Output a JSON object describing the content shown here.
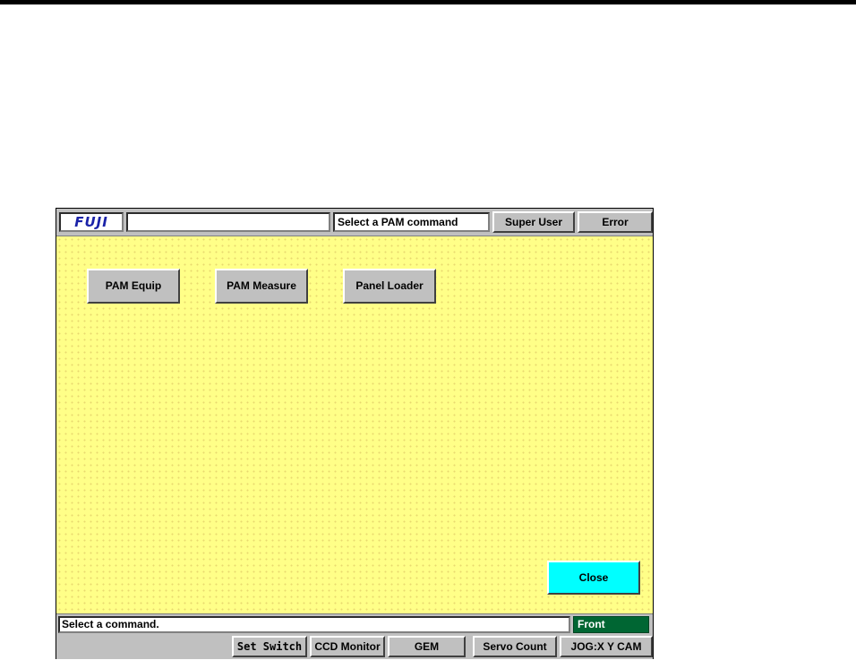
{
  "header": {
    "logo_text": "FUJI",
    "title_value": "",
    "prompt": "Select a PAM command",
    "user_button": "Super User",
    "error_button": "Error"
  },
  "commands": [
    {
      "label": "PAM Equip"
    },
    {
      "label": "PAM Measure"
    },
    {
      "label": "Panel Loader"
    }
  ],
  "close_button": "Close",
  "status": {
    "message": "Select a command.",
    "mode": "Front"
  },
  "toolbar": [
    {
      "label": "Set Switch"
    },
    {
      "label": "CCD Monitor"
    },
    {
      "label": "GEM"
    },
    {
      "label": "Servo Count"
    },
    {
      "label": "JOG:X Y CAM"
    }
  ],
  "colors": {
    "panel_bg": "#ffff88",
    "close_bg": "#00ffff",
    "mode_bg": "#006633",
    "logo": "#1a22a8"
  }
}
